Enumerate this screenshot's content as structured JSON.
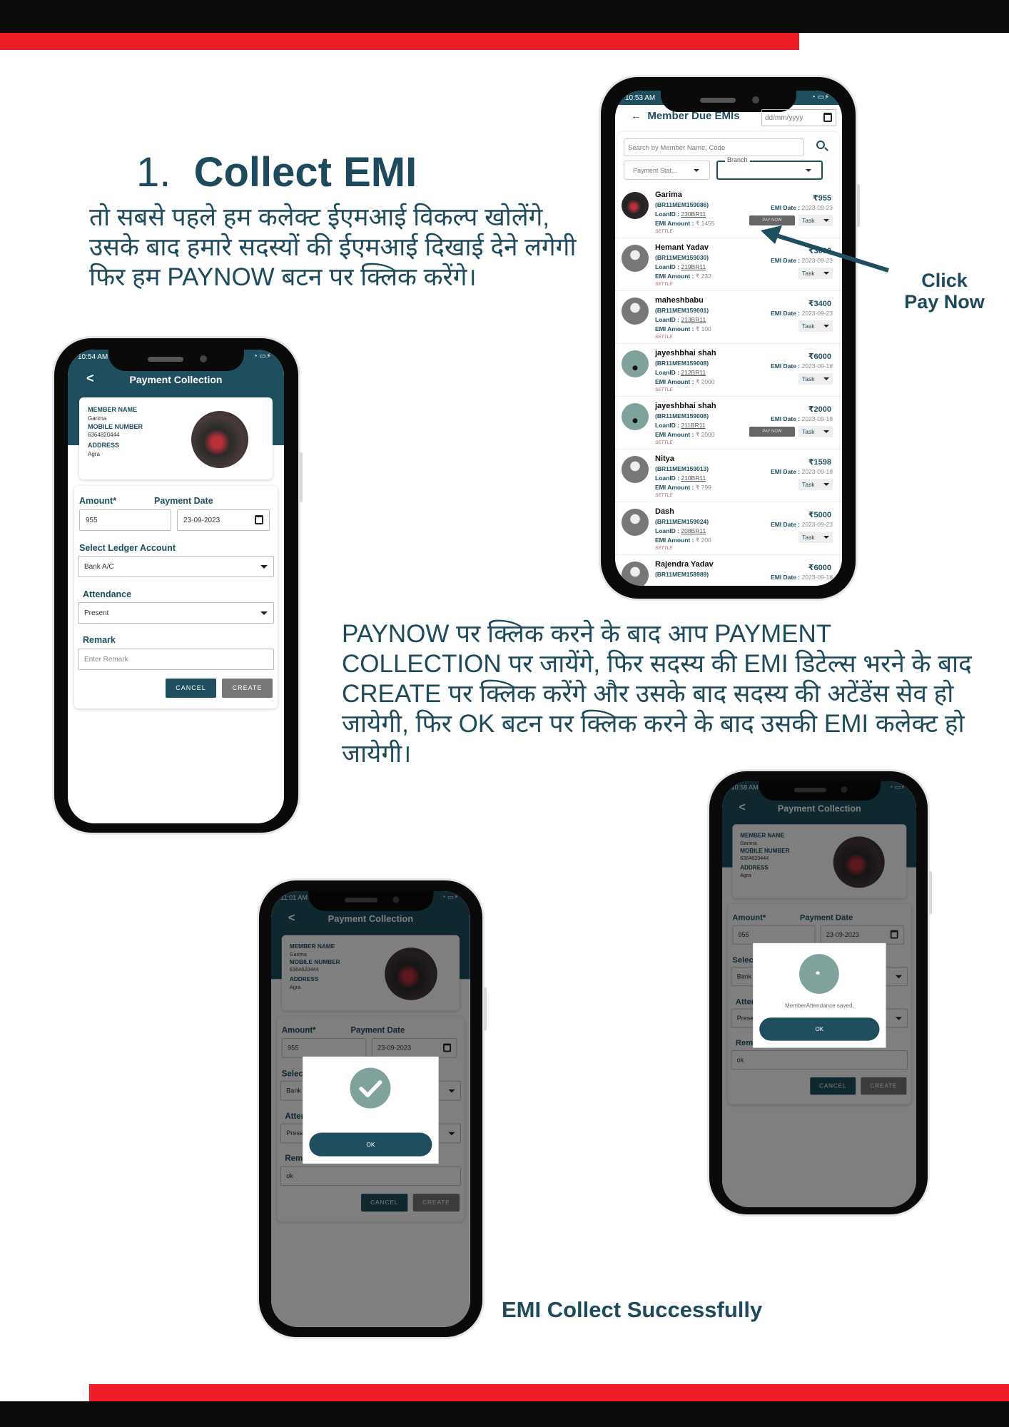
{
  "heading": {
    "number": "1.",
    "title": "Collect EMI"
  },
  "intro_text": "तो सबसे पहले हम कलेक्ट ईएमआई विकल्प खोलेंगे, उसके बाद हमारे सदस्यों की ईएमआई दिखाई देने लगेगी फिर हम PAYNOW बटन पर क्लिक करेंगे।",
  "callout": {
    "line1": "Click",
    "line2": "Pay Now"
  },
  "step_text": "PAYNOW पर क्लिक करने के बाद आप PAYMENT COLLECTION पर जायेंगे, फिर सदस्य की EMI डिटेल्स भरने के बाद CREATE पर क्लिक करेंगे और उसके बाद सदस्य की अटेंडेंस सेव हो जायेगी, फिर OK बटन पर क्लिक करने के बाद उसकी EMI कलेक्ट हो जायेगी।",
  "success_caption": "EMI Collect Successfully",
  "colors": {
    "brand": "#1f4e5f",
    "accent_red": "#ee1c25"
  },
  "member_due": {
    "time": "10:53 AM",
    "title": "Member Due EMIs",
    "date_placeholder": "dd/mm/yyyy",
    "search_placeholder": "Search by Member Name, Code",
    "payment_status_placeholder": "Payment Stat...",
    "branch_label": "Branch",
    "loan_label": "LoanID :",
    "emi_amount_label": "EMI Amount :",
    "emi_date_label": "EMI Date :",
    "settle_label": "SETTLE",
    "task_label": "Task",
    "pay_now_label": "PAY NOW",
    "rows": [
      {
        "name": "Garima",
        "code": "(BR11MEM159086)",
        "loan": "230BR11",
        "emi": "₹ 1455",
        "amount": "₹955",
        "date": "2023-09-23",
        "pay_now": true,
        "photo": true
      },
      {
        "name": "Hemant Yadav",
        "code": "(BR11MEM159030)",
        "loan": "219BR11",
        "emi": "₹ 232",
        "amount": "₹3000",
        "date": "2023-09-23",
        "pay_now": false
      },
      {
        "name": "maheshbabu",
        "code": "(BR11MEM159001)",
        "loan": "213BR11",
        "emi": "₹ 100",
        "amount": "₹3400",
        "date": "2023-09-23",
        "pay_now": false
      },
      {
        "name": "jayeshbhai shah",
        "code": "(BR11MEM159008)",
        "loan": "212BR11",
        "emi": "₹ 2000",
        "amount": "₹6000",
        "date": "2023-09-18",
        "pay_now": false,
        "teal": true
      },
      {
        "name": "jayeshbhai shah",
        "code": "(BR11MEM159008)",
        "loan": "211BR11",
        "emi": "₹ 2000",
        "amount": "₹2000",
        "date": "2023-09-18",
        "pay_now": true,
        "teal": true
      },
      {
        "name": "Nitya",
        "code": "(BR11MEM159013)",
        "loan": "210BR11",
        "emi": "₹ 799",
        "amount": "₹1598",
        "date": "2023-09-18",
        "pay_now": false
      },
      {
        "name": "Dash",
        "code": "(BR11MEM159024)",
        "loan": "208BR11",
        "emi": "₹ 200",
        "amount": "₹5000",
        "date": "2023-09-23",
        "pay_now": false
      },
      {
        "name": "Rajendra Yadav",
        "code": "(BR11MEM158989)",
        "loan": "",
        "emi": "",
        "amount": "₹6000",
        "date": "2023-09-18",
        "pay_now": false
      }
    ]
  },
  "payment": {
    "title": "Payment Collection",
    "member_name_label": "MEMBER NAME",
    "member_name": "Garima",
    "mobile_label": "MOBILE NUMBER",
    "mobile": "6364820444",
    "address_label": "ADDRESS",
    "address": "Agra",
    "amount_label": "Amount*",
    "amount": "955",
    "date_label": "Payment Date",
    "date": "23-09-2023",
    "ledger_label": "Select Ledger Account",
    "ledger": "Bank A/C",
    "attendance_label": "Attendance",
    "attendance": "Present",
    "remark_label": "Remark",
    "remark_placeholder": "Enter Remark",
    "remark_filled": "ok",
    "cancel": "CANCEL",
    "create": "CREATE"
  },
  "screens": [
    {
      "time": "10:54 AM"
    },
    {
      "time": "10:58 AM",
      "dialog_message": "MemberAttendance saved.",
      "ok": "OK"
    },
    {
      "time": "11:01 AM",
      "ok": "OK"
    }
  ]
}
